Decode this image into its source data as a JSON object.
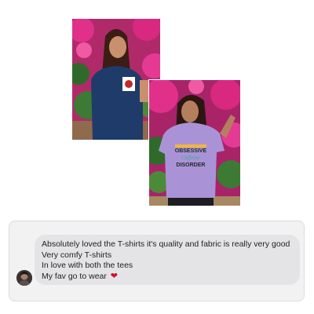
{
  "gallery": {
    "photo_1": {
      "subject": "woman in navy t-shirt with pocket print among pink bougainvillea"
    },
    "photo_2": {
      "subject": "woman in lavender t-shirt among pink bougainvillea",
      "tee_print": [
        "OBSESSIVE",
        "Caffeine",
        "DISORDER"
      ]
    }
  },
  "review": {
    "lines": [
      "Absolutely loved the T-shirts it's quality and fabric is really very good",
      "Very comfy T-shirts",
      "In love with both the tees",
      "My fav go to wear"
    ],
    "heart_icon": "red-heart-icon",
    "heart_glyph": "❤"
  },
  "colors": {
    "bubble": "#e4e4e6",
    "card": "#f2f2f3",
    "heart": "#c8102e"
  }
}
